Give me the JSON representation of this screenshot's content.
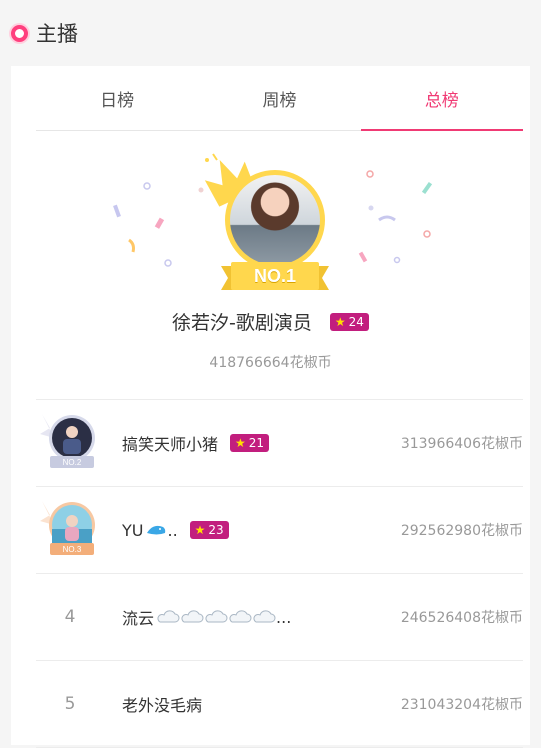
{
  "header": {
    "title": "主播"
  },
  "tabs": [
    {
      "label": "日榜",
      "active": false
    },
    {
      "label": "周榜",
      "active": false
    },
    {
      "label": "总榜",
      "active": true
    }
  ],
  "champion": {
    "rank_label": "NO.1",
    "name": "徐若汐-歌剧演员",
    "level": "24",
    "coins": "418766664花椒币"
  },
  "rows": [
    {
      "rank_label": "NO.2",
      "name": "搞笑天师小猪",
      "level": "21",
      "coins": "313966406花椒币"
    },
    {
      "rank_label": "NO.3",
      "name": "YU",
      "name_suffix": "..",
      "level": "23",
      "coins": "292562980花椒币"
    },
    {
      "rank": "4",
      "name": "流云",
      "name_suffix": "...",
      "coins": "246526408花椒币"
    },
    {
      "rank": "5",
      "name": "老外没毛病",
      "coins": "231043204花椒币"
    }
  ],
  "colors": {
    "accent": "#f03a74",
    "level_badge": "#c21e7e",
    "gold": "#ffd74d"
  }
}
